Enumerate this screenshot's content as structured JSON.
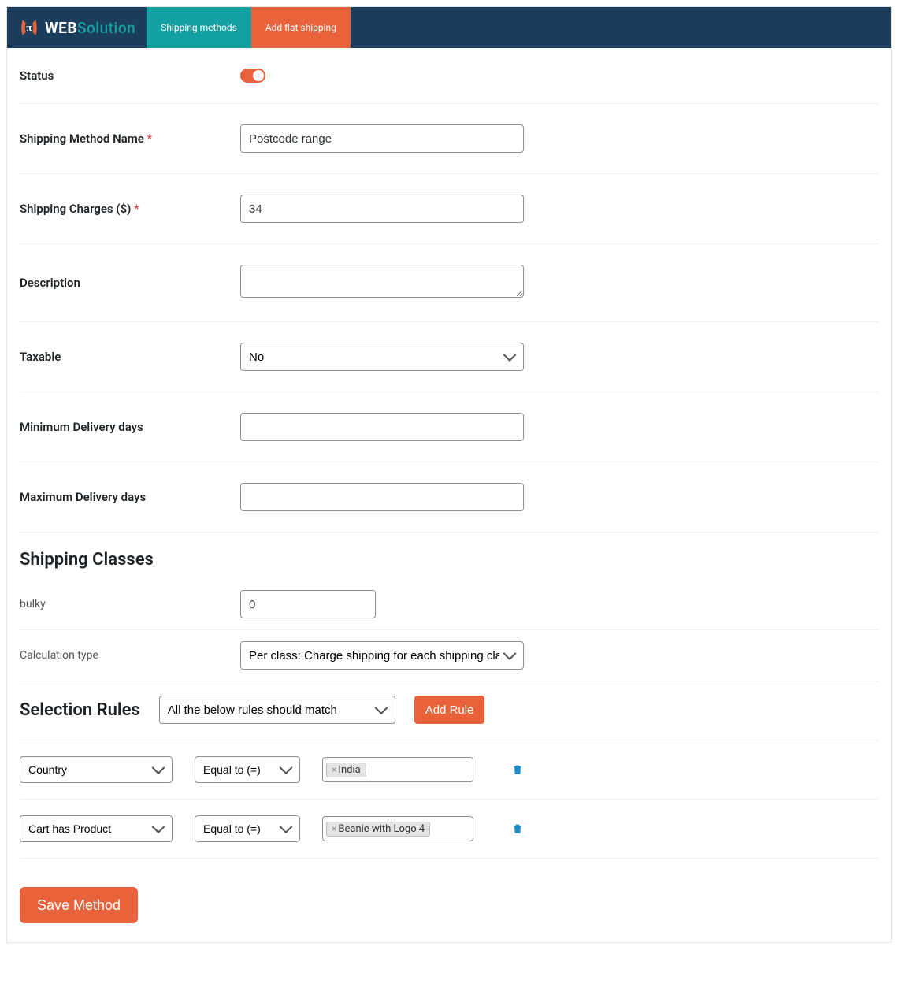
{
  "header": {
    "brand_web": "WEB",
    "brand_solution": "Solution",
    "tabs": [
      {
        "label": "Shipping methods"
      },
      {
        "label": "Add flat shipping"
      }
    ]
  },
  "form": {
    "status_label": "Status",
    "status_on": true,
    "name_label": "Shipping Method Name",
    "name_value": "Postcode range",
    "charges_label": "Shipping Charges ($)",
    "charges_value": "34",
    "desc_label": "Description",
    "desc_value": "",
    "taxable_label": "Taxable",
    "taxable_value": "No",
    "min_label": "Minimum Delivery days",
    "min_value": "",
    "max_label": "Maximum Delivery days",
    "max_value": ""
  },
  "shipping_classes": {
    "heading": "Shipping Classes",
    "bulky_label": "bulky",
    "bulky_value": "0",
    "calc_label": "Calculation type",
    "calc_value": "Per class: Charge shipping for each shipping class indivi"
  },
  "selection_rules": {
    "heading": "Selection Rules",
    "match_value": "All the below rules should match",
    "add_rule_label": "Add Rule",
    "rules": [
      {
        "field": "Country",
        "op": "Equal to (=)",
        "tag": "India"
      },
      {
        "field": "Cart has Product",
        "op": "Equal to (=)",
        "tag": "Beanie with Logo 4"
      }
    ]
  },
  "actions": {
    "save_label": "Save Method"
  },
  "required_mark": "*"
}
